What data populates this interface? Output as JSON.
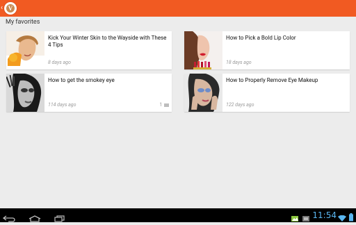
{
  "section_title": "My favorites",
  "articles": [
    {
      "title": "Kick Your Winter Skin to the Wayside with These 4 Tips",
      "time": "8 days ago",
      "comments": ""
    },
    {
      "title": "How to Pick a Bold Lip Color",
      "time": "18 days ago",
      "comments": ""
    },
    {
      "title": "How to get the smokey eye",
      "time": "114 days ago",
      "comments": "1"
    },
    {
      "title": "How to Properly Remove Eye Makeup",
      "time": "122 days ago",
      "comments": ""
    }
  ],
  "status_bar": {
    "clock": "11:54"
  },
  "colors": {
    "appbar": "#f15a22",
    "background": "#ececec",
    "clock": "#5ab6f0"
  },
  "icons": [
    "back-chevron-icon",
    "app-logo-icon",
    "comment-icon",
    "back-icon",
    "home-icon",
    "recents-icon",
    "gallery-icon",
    "image-icon",
    "wifi-icon",
    "battery-icon"
  ]
}
